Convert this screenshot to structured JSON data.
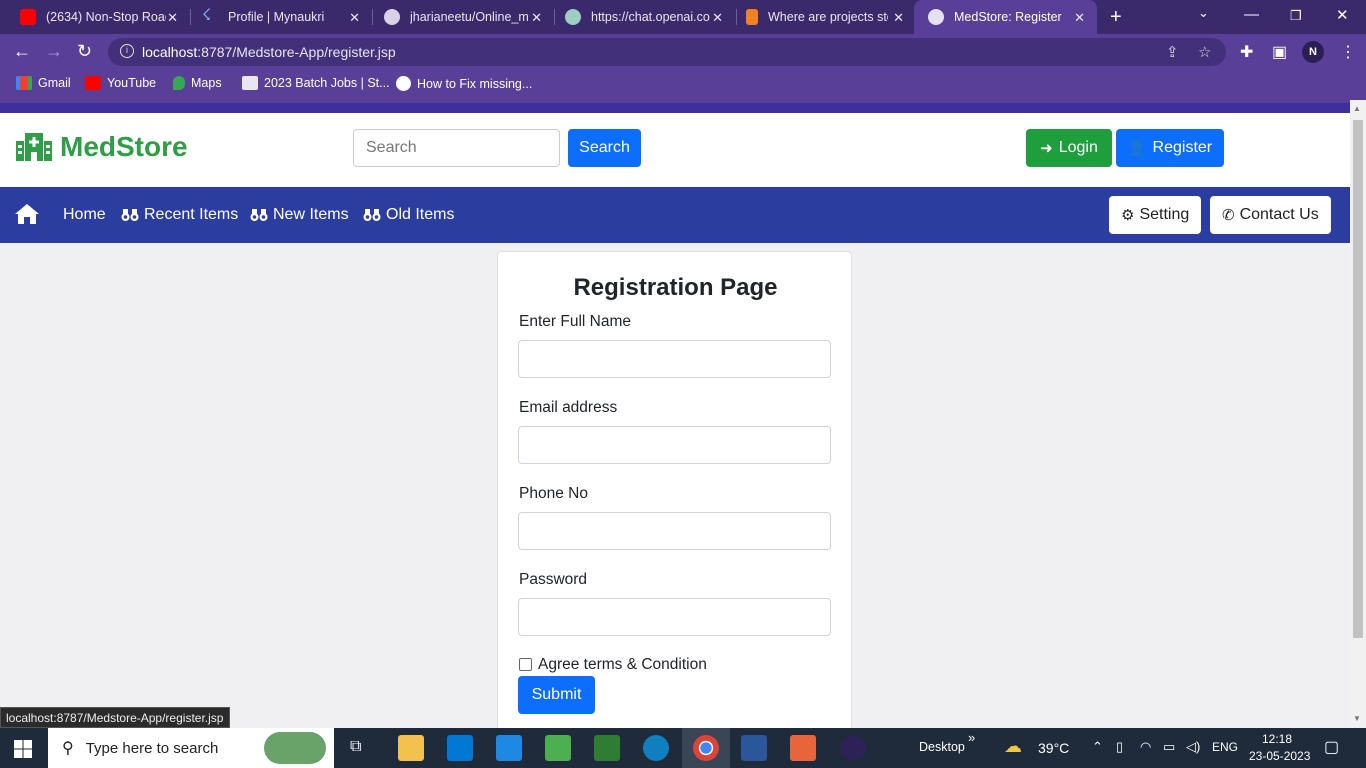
{
  "browser": {
    "tabs": [
      {
        "title": "(2634) Non-Stop Road",
        "favicon": "youtube-icon",
        "color": "#ff0000"
      },
      {
        "title": "Profile | Mynaukri",
        "favicon": "naukri-icon",
        "color": "#4a90e2"
      },
      {
        "title": "jharianeetu/Online_m",
        "favicon": "github-icon",
        "color": "#222222"
      },
      {
        "title": "https://chat.openai.co",
        "favicon": "openai-icon",
        "color": "#10a37f"
      },
      {
        "title": "Where are projects sto",
        "favicon": "stackoverflow-icon",
        "color": "#f48024"
      },
      {
        "title": "MedStore: Register",
        "favicon": "globe-icon",
        "color": "#dddddd"
      }
    ],
    "url_host": "localhost",
    "url_rest": ":8787/Medstore-App/register.jsp",
    "profile_initial": "N",
    "bookmarks": [
      {
        "label": "Gmail",
        "icon": "gmail-icon"
      },
      {
        "label": "YouTube",
        "icon": "youtube-icon"
      },
      {
        "label": "Maps",
        "icon": "maps-icon"
      },
      {
        "label": "2023 Batch Jobs | St...",
        "icon": "jobs-icon"
      },
      {
        "label": "How to Fix missing...",
        "icon": "wordpress-icon"
      }
    ],
    "status_url": "localhost:8787/Medstore-App/register.jsp"
  },
  "site": {
    "brand": "MedStore",
    "brand_color": "#2e9e47",
    "search_placeholder": "Search",
    "search_button": "Search",
    "login_button": "Login",
    "register_button": "Register",
    "nav": {
      "items": [
        "Home",
        "Recent Items",
        "New Items",
        "Old Items"
      ],
      "setting": "Setting",
      "contact": "Contact Us"
    }
  },
  "form": {
    "title": "Registration Page",
    "fields": [
      {
        "label": "Enter Full Name",
        "value": ""
      },
      {
        "label": "Email address",
        "value": ""
      },
      {
        "label": "Phone No",
        "value": ""
      },
      {
        "label": "Password",
        "value": ""
      }
    ],
    "agree_label": "Agree terms & Condition",
    "agree_checked": false,
    "submit": "Submit"
  },
  "taskbar": {
    "search_text": "Type here to search",
    "desktop_label": "Desktop",
    "weather": "39°C",
    "language": "ENG",
    "time": "12:18",
    "date": "23-05-2023"
  }
}
